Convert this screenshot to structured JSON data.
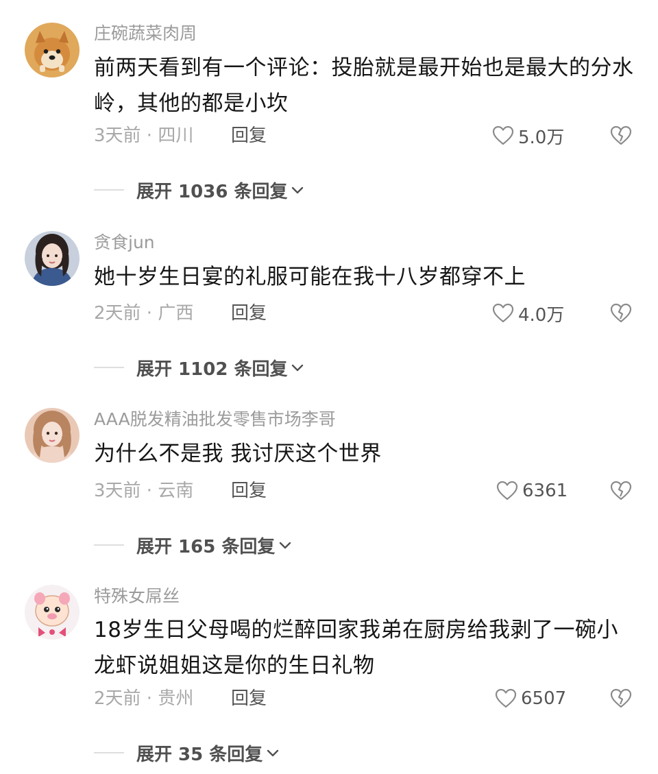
{
  "comments": [
    {
      "username": "庄碗蔬菜肉周",
      "avatar": "shiba-dog-avatar",
      "content": "前两天看到有一个评论：投胎就是最开始也是最大的分水岭，其他的都是小坎",
      "time": "3天前",
      "location": "四川",
      "reply_label": "回复",
      "likes": "5.0万",
      "expand_label": "展开 1036 条回复"
    },
    {
      "username": "贪食jun",
      "avatar": "girl-photo-avatar",
      "content": "她十岁生日宴的礼服可能在我十八岁都穿不上",
      "time": "2天前",
      "location": "广西",
      "reply_label": "回复",
      "likes": "4.0万",
      "expand_label": "展开 1102 条回复"
    },
    {
      "username": "AAA脱发精油批发零售市场李哥",
      "avatar": "girl-selfie-avatar",
      "content": "为什么不是我 我讨厌这个世界",
      "time": "3天前",
      "location": "云南",
      "reply_label": "回复",
      "likes": "6361",
      "expand_label": "展开 165 条回复"
    },
    {
      "username": "特殊女屌丝",
      "avatar": "cartoon-pig-avatar",
      "content": "18岁生日父母喝的烂醉回家我弟在厨房给我剥了一碗小龙虾说姐姐这是你的生日礼物",
      "time": "2天前",
      "location": "贵州",
      "reply_label": "回复",
      "likes": "6507",
      "expand_label": "展开 35 条回复"
    }
  ],
  "meta_separator": " · ",
  "colors": {
    "username": "#9b9b9b",
    "content": "#161616",
    "meta": "#a8a8a8",
    "action": "#555555"
  },
  "icons": {
    "like": "heart-outline-icon",
    "dislike": "broken-heart-icon",
    "expand": "chevron-down-icon"
  }
}
